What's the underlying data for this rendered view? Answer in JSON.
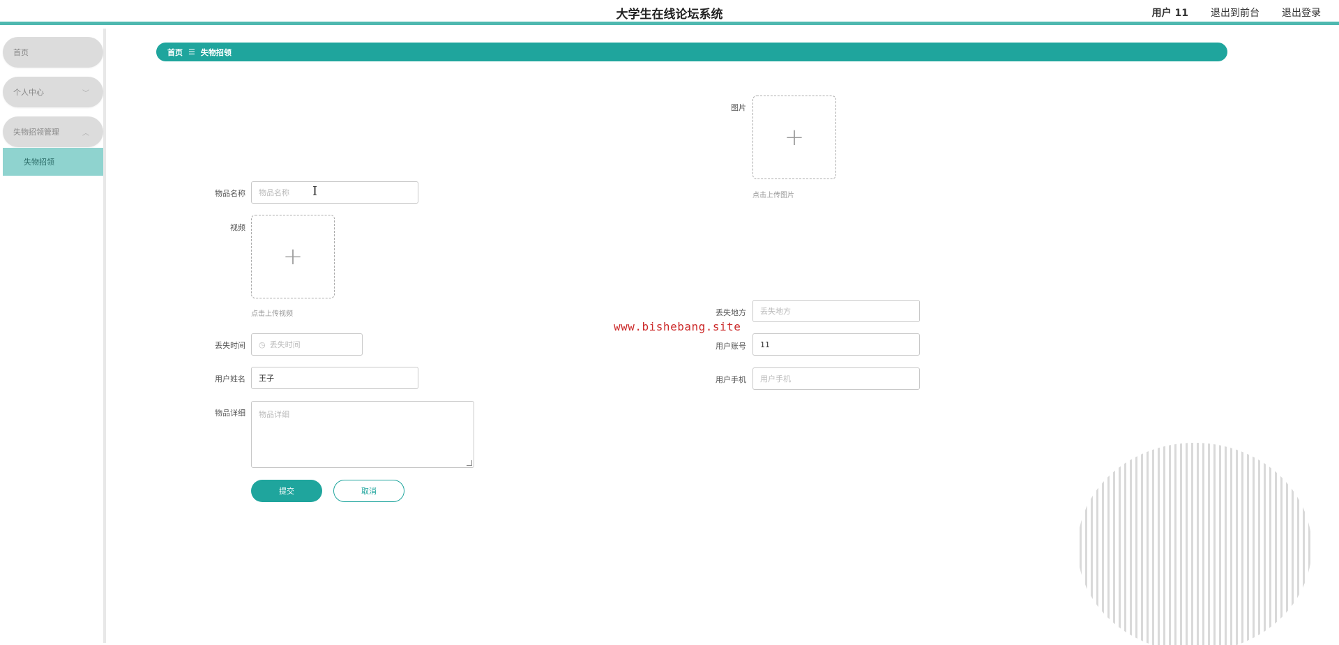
{
  "header": {
    "title": "大学生在线论坛系统",
    "user": "用户 11",
    "front_link": "退出到前台",
    "logout": "退出登录"
  },
  "sidebar": {
    "items": [
      {
        "label": "首页"
      },
      {
        "label": "个人中心",
        "chevron": "﹀"
      },
      {
        "label": "失物招领管理",
        "chevron": "︿"
      }
    ],
    "sub_item": "失物招领"
  },
  "breadcrumb": {
    "home": "首页",
    "separator": "☰",
    "current": "失物招领"
  },
  "form": {
    "item_name": {
      "label": "物品名称",
      "placeholder": "物品名称"
    },
    "image": {
      "label": "图片",
      "hint": "点击上传图片"
    },
    "video": {
      "label": "视频",
      "hint": "点击上传视频"
    },
    "lost_place": {
      "label": "丢失地方",
      "placeholder": "丢失地方"
    },
    "lost_time": {
      "label": "丢失时间",
      "placeholder": "丢失时间"
    },
    "user_account": {
      "label": "用户账号",
      "value": "11"
    },
    "user_name": {
      "label": "用户姓名",
      "value": "王子"
    },
    "user_phone": {
      "label": "用户手机",
      "placeholder": "用户手机"
    },
    "item_detail": {
      "label": "物品详细",
      "placeholder": "物品详细"
    },
    "submit": "提交",
    "cancel": "取消"
  },
  "watermark": "www.bishebang.site",
  "colors": {
    "accent": "#1fa59d",
    "header_border": "#4fb8b0",
    "sidebar_active": "#8fd3cf",
    "watermark": "#cc2a2a"
  }
}
